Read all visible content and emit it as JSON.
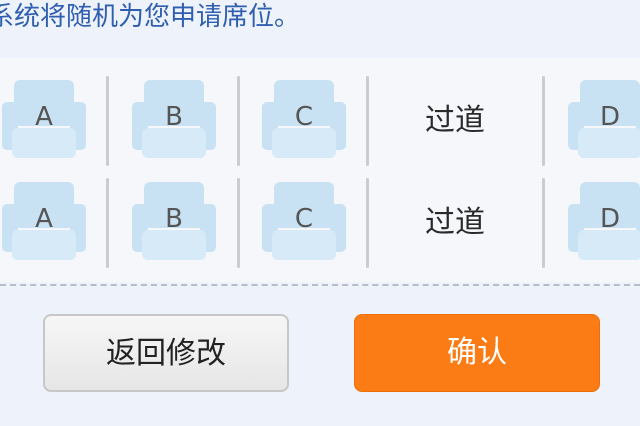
{
  "notice": {
    "text": "系统将随机为您申请席位。"
  },
  "seat_map": {
    "rows": [
      {
        "seats": [
          "A",
          "B",
          "C",
          "D"
        ],
        "aisle_label": "过道"
      },
      {
        "seats": [
          "A",
          "B",
          "C",
          "D"
        ],
        "aisle_label": "过道"
      }
    ],
    "seat_icon": "seat-icon",
    "seat_color": "#c9e2f3"
  },
  "actions": {
    "back_label": "返回修改",
    "confirm_label": "确认",
    "confirm_color": "#fb7b14"
  }
}
